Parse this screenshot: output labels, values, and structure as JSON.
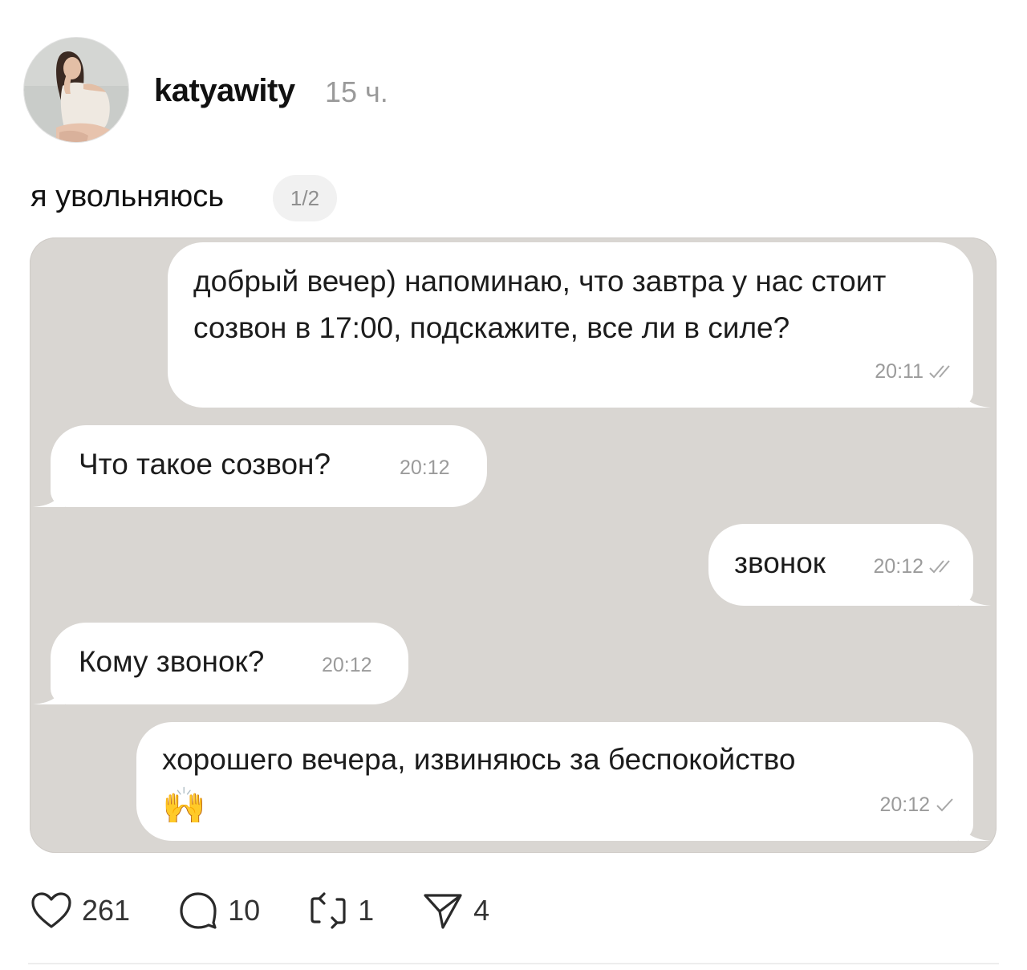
{
  "post": {
    "username": "katyawity",
    "time": "15 ч.",
    "text": "я увольняюсь",
    "page_indicator": "1/2"
  },
  "chat": {
    "messages": [
      {
        "direction": "out",
        "text": "добрый вечер) напоминаю, что завтра у нас стоит созвон в 17:00, подскажите, все ли в силе?",
        "time": "20:11",
        "status": "read"
      },
      {
        "direction": "in",
        "text": "Что такое созвон?",
        "time": "20:12"
      },
      {
        "direction": "out",
        "text": "звонок",
        "time": "20:12",
        "status": "read"
      },
      {
        "direction": "in",
        "text": "Кому звонок?",
        "time": "20:12"
      },
      {
        "direction": "out",
        "text": "хорошего вечера, извиняюсь за беспокойство",
        "emoji": "🙌",
        "time": "20:12",
        "status": "sent"
      }
    ]
  },
  "actions": {
    "likes": "261",
    "comments": "10",
    "reposts": "1",
    "shares": "4"
  },
  "icons": {
    "like": "heart-icon",
    "comment": "comment-bubble-icon",
    "repost": "repost-icon",
    "share": "send-icon",
    "read_status": "double-check-icon",
    "sent_status": "single-check-icon"
  },
  "colors": {
    "chat_background": "#d9d6d2",
    "bubble": "#ffffff",
    "meta_text": "#9b9b9b",
    "username": "#111111",
    "time_text": "#9a9a9a"
  }
}
